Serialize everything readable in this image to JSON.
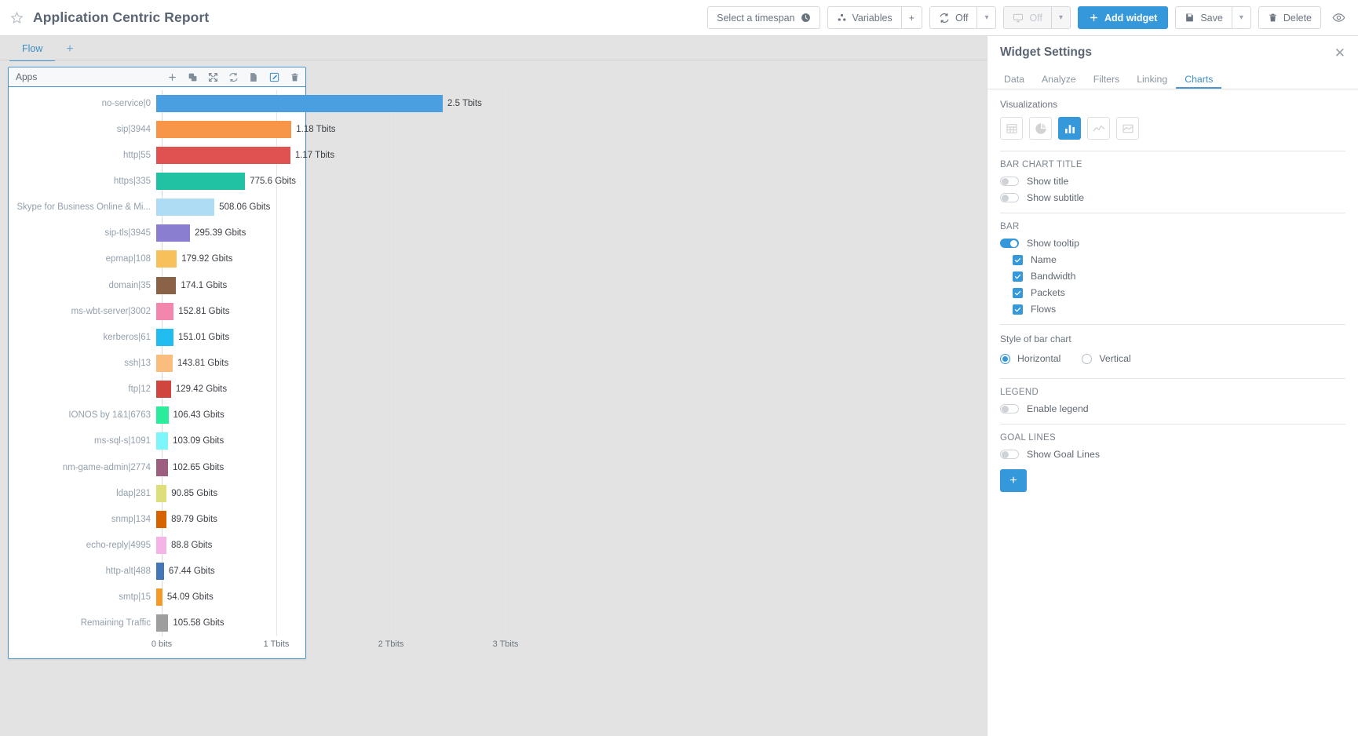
{
  "header": {
    "title": "Application Centric Report",
    "star_icon": "star-outline-icon",
    "timespan_label": "Select a timespan",
    "variables_label": "Variables",
    "add_variable_label": "+",
    "refresh_label": "Off",
    "presentation_label": "Off",
    "add_widget_label": "Add widget",
    "save_label": "Save",
    "delete_label": "Delete",
    "preview_icon": "eye-icon"
  },
  "tabs": {
    "items": [
      {
        "label": "Flow",
        "active": true
      }
    ],
    "add_label": "+"
  },
  "widget": {
    "title": "Apps",
    "icons": [
      "plus-icon",
      "duplicate-icon",
      "fullscreen-icon",
      "refresh-icon",
      "export-icon",
      "edit-icon",
      "trash-icon"
    ]
  },
  "chart_data": {
    "type": "bar",
    "orientation": "horizontal",
    "title": "Apps",
    "xlabel": "",
    "ylabel": "",
    "xlim": [
      0,
      3000
    ],
    "unit": "Gbits",
    "grid": true,
    "legend": false,
    "xticks": [
      "0 bits",
      "1 Tbits",
      "2 Tbits",
      "3 Tbits"
    ],
    "xtick_values": [
      0,
      1000,
      2000,
      3000
    ],
    "categories": [
      "no-service|0",
      "sip|3944",
      "http|55",
      "https|335",
      "Skype for Business Online & Mi...",
      "sip-tls|3945",
      "epmap|108",
      "domain|35",
      "ms-wbt-server|3002",
      "kerberos|61",
      "ssh|13",
      "ftp|12",
      "IONOS by 1&1|6763",
      "ms-sql-s|1091",
      "nm-game-admin|2774",
      "ldap|281",
      "snmp|134",
      "echo-reply|4995",
      "http-alt|488",
      "smtp|15",
      "Remaining Traffic"
    ],
    "values": [
      2500,
      1180,
      1170,
      775.6,
      508.06,
      295.39,
      179.92,
      174.1,
      152.81,
      151.01,
      143.81,
      129.42,
      106.43,
      103.09,
      102.65,
      90.85,
      89.79,
      88.8,
      67.44,
      54.09,
      105.58
    ],
    "value_labels": [
      "2.5 Tbits",
      "1.18 Tbits",
      "1.17 Tbits",
      "775.6 Gbits",
      "508.06 Gbits",
      "295.39 Gbits",
      "179.92 Gbits",
      "174.1 Gbits",
      "152.81 Gbits",
      "151.01 Gbits",
      "143.81 Gbits",
      "129.42 Gbits",
      "106.43 Gbits",
      "103.09 Gbits",
      "102.65 Gbits",
      "90.85 Gbits",
      "89.79 Gbits",
      "88.8 Gbits",
      "67.44 Gbits",
      "54.09 Gbits",
      "105.58 Gbits"
    ],
    "colors": [
      "#4a9fe0",
      "#f79548",
      "#e05252",
      "#21c2a4",
      "#aedcf5",
      "#8a7ed1",
      "#f7c05a",
      "#8a6247",
      "#f286ad",
      "#21bdf0",
      "#fbbd7e",
      "#d1453f",
      "#2bec9b",
      "#7df6fa",
      "#9c5f80",
      "#dede7a",
      "#d66200",
      "#f5b4e6",
      "#4476b8",
      "#f59a26",
      "#9e9e9e"
    ]
  },
  "panel": {
    "title": "Widget Settings",
    "close_icon": "close-icon",
    "tabs": [
      {
        "label": "Data",
        "active": false
      },
      {
        "label": "Analyze",
        "active": false
      },
      {
        "label": "Filters",
        "active": false
      },
      {
        "label": "Linking",
        "active": false
      },
      {
        "label": "Charts",
        "active": true
      }
    ],
    "visualizations_label": "Visualizations",
    "visualizations": [
      {
        "name": "table-viz-icon",
        "active": false
      },
      {
        "name": "pie-viz-icon",
        "active": false
      },
      {
        "name": "bar-viz-icon",
        "active": true
      },
      {
        "name": "line-viz-icon",
        "active": false
      },
      {
        "name": "area-viz-icon",
        "active": false
      }
    ],
    "bar_chart_title_section": "BAR CHART TITLE",
    "show_title": {
      "label": "Show title",
      "on": false
    },
    "show_subtitle": {
      "label": "Show subtitle",
      "on": false
    },
    "bar_section": "BAR",
    "show_tooltip": {
      "label": "Show tooltip",
      "on": true
    },
    "tooltip_fields": [
      {
        "label": "Name",
        "checked": true
      },
      {
        "label": "Bandwidth",
        "checked": true
      },
      {
        "label": "Packets",
        "checked": true
      },
      {
        "label": "Flows",
        "checked": true
      }
    ],
    "style_label": "Style of bar chart",
    "style_options": [
      {
        "label": "Horizontal",
        "selected": true
      },
      {
        "label": "Vertical",
        "selected": false
      }
    ],
    "legend_section": "LEGEND",
    "enable_legend": {
      "label": "Enable legend",
      "on": false
    },
    "goal_lines_section": "GOAL LINES",
    "show_goal_lines": {
      "label": "Show Goal Lines",
      "on": false
    },
    "add_goal_line_label": "+"
  }
}
